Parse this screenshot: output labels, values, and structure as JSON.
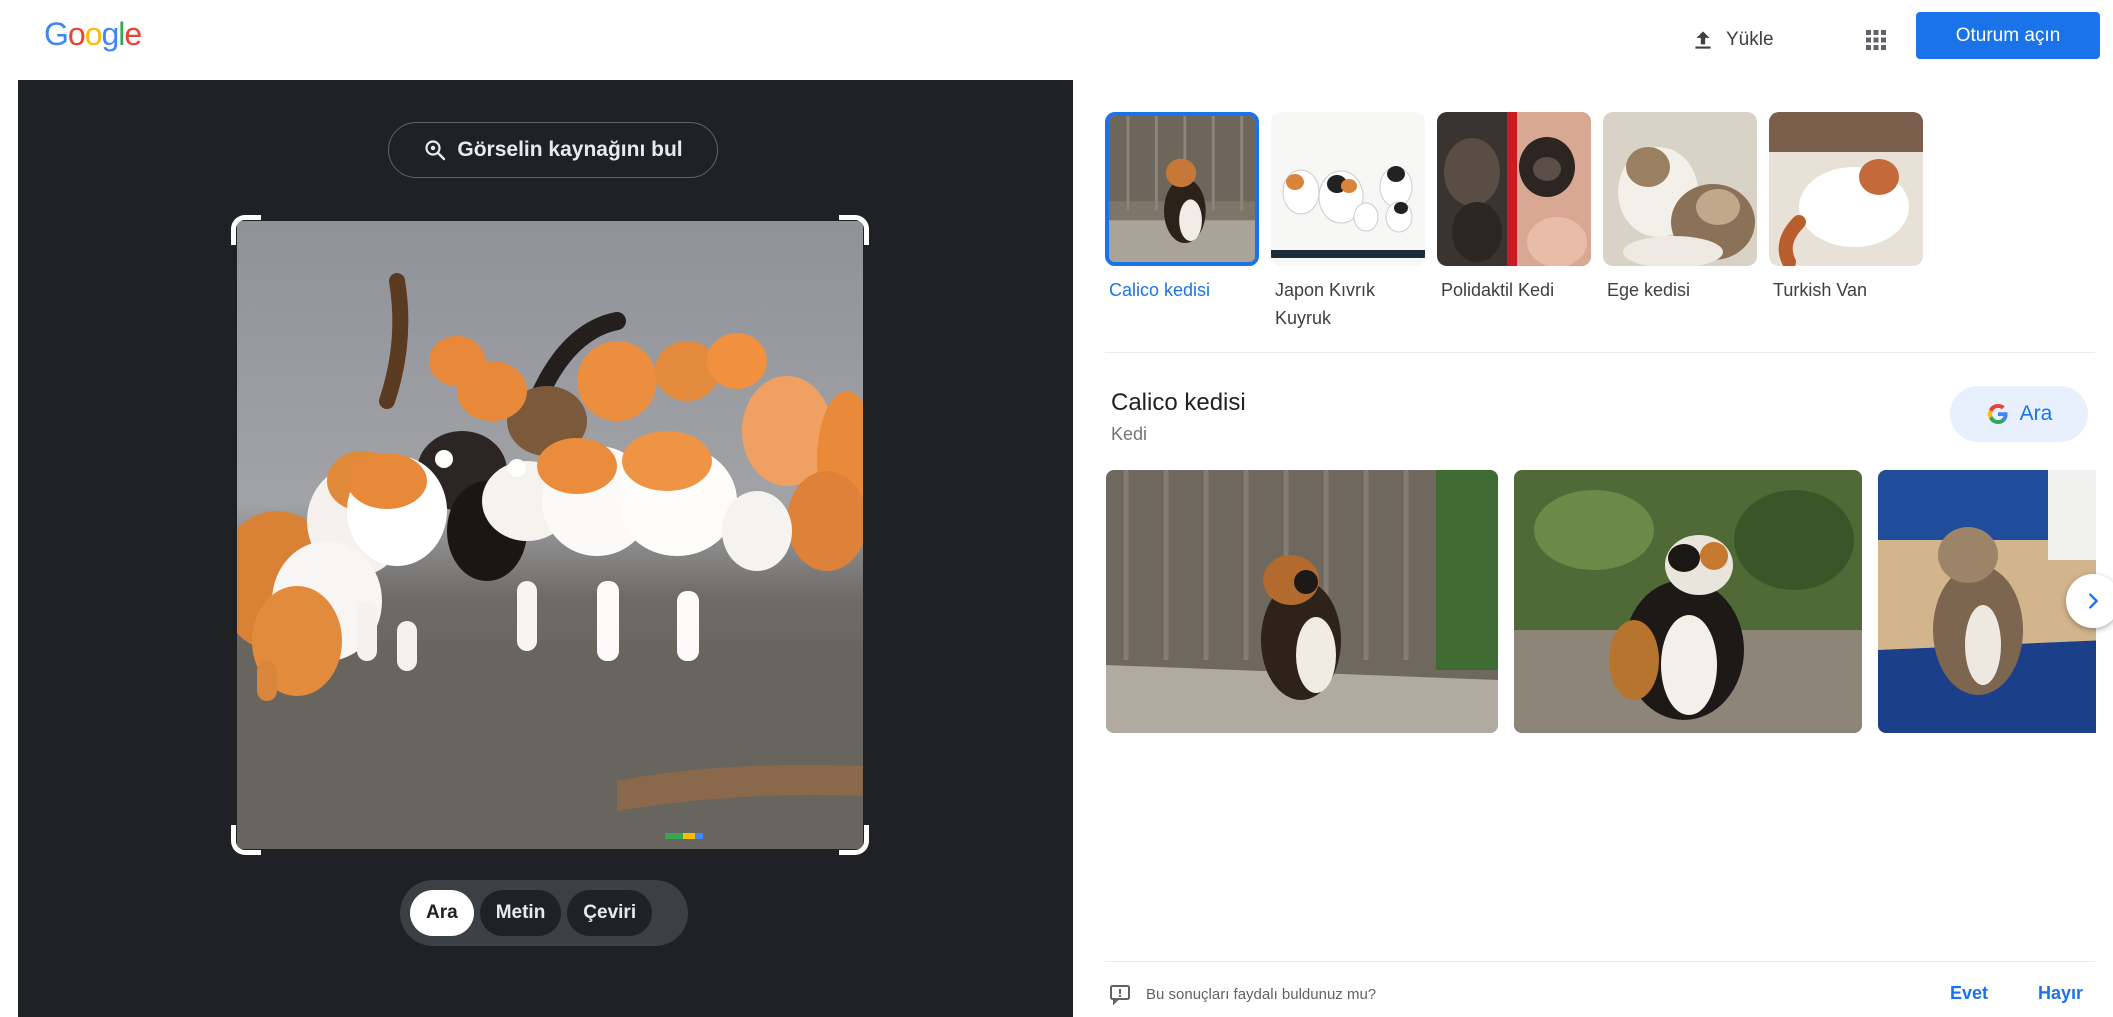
{
  "header": {
    "logo": [
      "G",
      "o",
      "o",
      "g",
      "l",
      "e"
    ],
    "logo_colors": [
      "#4285f4",
      "#ea4335",
      "#fbbc05",
      "#4285f4",
      "#34a853",
      "#ea4335"
    ],
    "upload_label": "Yükle",
    "apps_icon": "grid-icon",
    "signin_label": "Oturum açın"
  },
  "lens": {
    "find_source_label": "Görselin kaynağını bul",
    "modes": [
      {
        "label": "Ara",
        "active": true
      },
      {
        "label": "Metin",
        "active": false
      },
      {
        "label": "Çeviri",
        "active": false
      }
    ]
  },
  "related": [
    {
      "label": "Calico kedisi",
      "active": true
    },
    {
      "label": "Japon Kıvrık Kuyruk",
      "active": false
    },
    {
      "label": "Polidaktil Kedi",
      "active": false
    },
    {
      "label": "Ege kedisi",
      "active": false
    },
    {
      "label": "Turkish Van",
      "active": false
    }
  ],
  "entity": {
    "title": "Calico kedisi",
    "subtitle": "Kedi",
    "search_label": "Ara"
  },
  "feedback": {
    "question": "Bu sonuçları faydalı buldunuz mu?",
    "yes": "Evet",
    "no": "Hayır"
  },
  "colors": {
    "accent": "#1a73e8",
    "dark_panel": "#202124"
  }
}
